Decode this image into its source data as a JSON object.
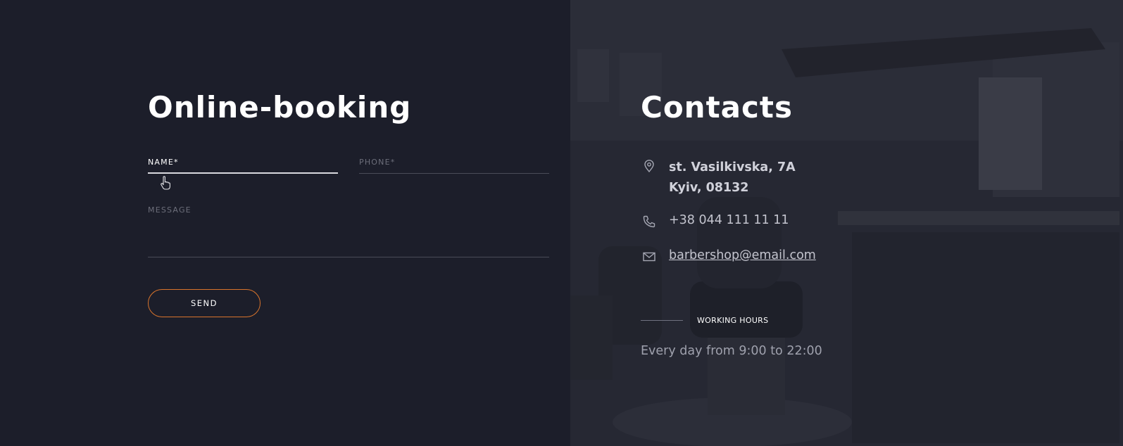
{
  "booking": {
    "title": "Online-booking",
    "name_label": "NAME*",
    "phone_label": "PHONE*",
    "message_label": "MESSAGE",
    "send_label": "SEND"
  },
  "contacts": {
    "title": "Contacts",
    "address_line1": "st. Vasilkivska, 7A",
    "address_line2": "Kyiv, 08132",
    "phone": "+38 044 111 11 11",
    "email": "barbershop@email.com",
    "hours_label": "WORKING HOURS",
    "hours_text": "Every day from 9:00 to 22:00"
  },
  "icons": {
    "address": "map-pin-icon",
    "phone": "phone-icon",
    "email": "mail-icon",
    "cursor": "hand-cursor-icon"
  },
  "colors": {
    "background": "#1c1e2a",
    "accent": "#d9742c",
    "text_primary": "#ffffff",
    "text_muted": "#6c6e7a"
  }
}
